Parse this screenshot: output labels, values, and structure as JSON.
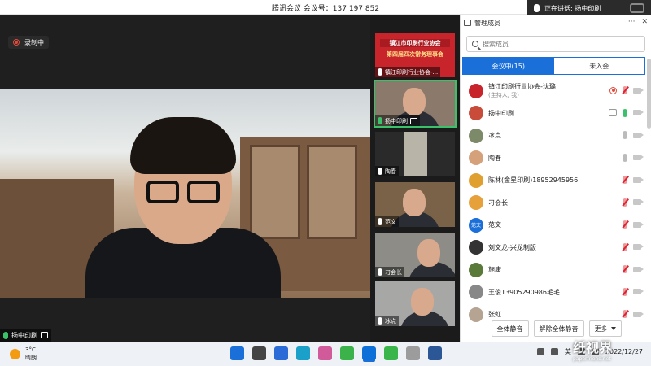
{
  "titlebar": {
    "title": "腾讯会议 会议号：137 197 852"
  },
  "speaking": {
    "label": "正在讲话: 扬中印刷"
  },
  "stage": {
    "recording_label": "录制中",
    "main_speaker": "扬中印刷"
  },
  "thumbnails": [
    {
      "name": "镇江印刷行业协会-...",
      "banner1": "镇江市印刷行业协会",
      "banner2": "第四届四次常务理事会"
    },
    {
      "name": "扬中印刷"
    },
    {
      "name": "陶春"
    },
    {
      "name": "范文"
    },
    {
      "name": "刁会长"
    },
    {
      "name": "冰点"
    }
  ],
  "panel": {
    "title": "管理成员",
    "search_placeholder": "搜索成员",
    "tab_in": "会议中(15)",
    "tab_out": "未入会",
    "members": [
      {
        "name": "镇江印刷行业协会-沈璐",
        "sub": "(主持人, 我)",
        "color": "#c8242b",
        "avatar": "",
        "mic": "muted",
        "rec": true
      },
      {
        "name": "扬中印刷",
        "sub": "",
        "color": "#c94c3a",
        "avatar": "",
        "mic": "green",
        "host": true
      },
      {
        "name": "冰点",
        "sub": "",
        "color": "#7d8a6a",
        "avatar": "",
        "mic": "on"
      },
      {
        "name": "陶春",
        "sub": "",
        "color": "#d5a17a",
        "avatar": "",
        "mic": "on"
      },
      {
        "name": "陈林(金星印刷)18952945956",
        "sub": "",
        "color": "#e0a030",
        "avatar": "",
        "mic": "muted"
      },
      {
        "name": "刁会长",
        "sub": "",
        "color": "#e6a13a",
        "avatar": "",
        "mic": "muted"
      },
      {
        "name": "范文",
        "sub": "",
        "color": "#1b6fd8",
        "avatar": "范文",
        "mic": "muted"
      },
      {
        "name": "刘文龙-兴龙制版",
        "sub": "",
        "color": "#333",
        "avatar": "",
        "mic": "muted"
      },
      {
        "name": "施康",
        "sub": "",
        "color": "#5a7a3a",
        "avatar": "",
        "mic": "muted"
      },
      {
        "name": "王俊13905290986毛毛",
        "sub": "",
        "color": "#888",
        "avatar": "",
        "mic": "muted"
      },
      {
        "name": "张虹",
        "sub": "",
        "color": "#b6a493",
        "avatar": "",
        "mic": "muted"
      }
    ],
    "btn_mute_all": "全体静音",
    "btn_unmute_all": "解除全体静音",
    "btn_more": "更多"
  },
  "taskbar": {
    "temp": "3°C",
    "weather": "晴朗",
    "lang": "英",
    "date": "2022/12/27"
  },
  "watermark": {
    "text": "纸视界",
    "url": "paperfriend.net"
  }
}
